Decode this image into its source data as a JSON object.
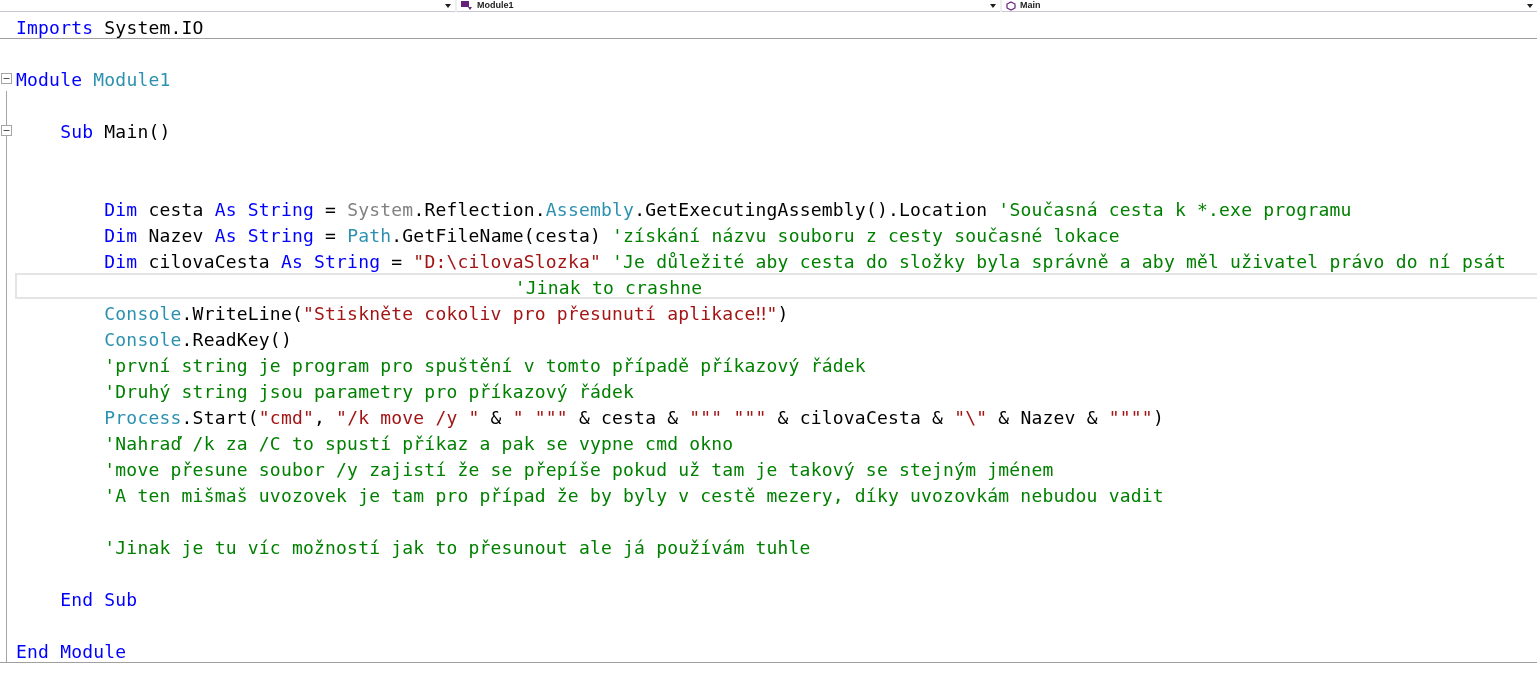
{
  "navigation_bar": {
    "dropdowns": [
      {
        "kind": "project"
      },
      {
        "kind": "type",
        "label": "Module1"
      },
      {
        "kind": "member",
        "label": "Main"
      }
    ]
  },
  "lines": [
    {
      "current": false,
      "separator_below": true,
      "tokens": [
        {
          "kind": "keyword",
          "text": "Imports"
        },
        {
          "kind": "plain",
          "text": " System.IO"
        }
      ]
    },
    {
      "current": false,
      "separator_below": false
    },
    {
      "current": false,
      "separator_below": false,
      "expanded": true,
      "tokens": [
        {
          "kind": "keyword",
          "text": "Module"
        },
        {
          "kind": "type",
          "text": " Module1"
        }
      ]
    },
    {
      "current": false,
      "separator_below": false
    },
    {
      "current": false,
      "separator_below": false,
      "expanded": true,
      "tokens": [
        {
          "kind": "keyword",
          "text": "    Sub"
        },
        {
          "kind": "plain",
          "text": " Main()"
        }
      ]
    },
    {
      "current": false,
      "separator_below": false
    },
    {
      "current": false,
      "separator_below": false
    },
    {
      "current": false,
      "separator_below": false,
      "tokens": [
        {
          "kind": "keyword",
          "text": "        Dim"
        },
        {
          "kind": "plain",
          "text": " cesta "
        },
        {
          "kind": "keyword",
          "text": "As String"
        },
        {
          "kind": "plain",
          "text": " = "
        },
        {
          "kind": "grey",
          "text": "System"
        },
        {
          "kind": "plain",
          "text": ".Reflection."
        },
        {
          "kind": "type",
          "text": "Assembly"
        },
        {
          "kind": "plain",
          "text": ".GetExecutingAssembly().Location "
        },
        {
          "kind": "comment",
          "text": "'Současná cesta k *.exe programu"
        }
      ]
    },
    {
      "current": false,
      "separator_below": false,
      "tokens": [
        {
          "kind": "keyword",
          "text": "        Dim"
        },
        {
          "kind": "plain",
          "text": " Nazev "
        },
        {
          "kind": "keyword",
          "text": "As String"
        },
        {
          "kind": "plain",
          "text": " = "
        },
        {
          "kind": "type",
          "text": "Path"
        },
        {
          "kind": "plain",
          "text": ".GetFileName(cesta) "
        },
        {
          "kind": "comment",
          "text": "'získání názvu souboru z cesty současné lokace"
        }
      ]
    },
    {
      "current": false,
      "separator_below": false,
      "tokens": [
        {
          "kind": "keyword",
          "text": "        Dim"
        },
        {
          "kind": "plain",
          "text": " cilovaCesta "
        },
        {
          "kind": "keyword",
          "text": "As String"
        },
        {
          "kind": "plain",
          "text": " = "
        },
        {
          "kind": "string",
          "text": "\"D:\\cilovaSlozka\""
        },
        {
          "kind": "comment",
          "text": " 'Je důležité aby cesta do složky byla správně a aby měl uživatel právo do ní psát"
        }
      ]
    },
    {
      "current": true,
      "separator_below": false,
      "tokens": [
        {
          "kind": "comment",
          "text": "                                             'Jinak to crashne"
        }
      ]
    },
    {
      "current": false,
      "separator_below": false,
      "tokens": [
        {
          "kind": "type",
          "text": "        Console"
        },
        {
          "kind": "plain",
          "text": ".WriteLine("
        },
        {
          "kind": "string",
          "text": "\"Stiskněte cokoliv pro přesunutí aplikace‼\""
        },
        {
          "kind": "plain",
          "text": ")"
        }
      ]
    },
    {
      "current": false,
      "separator_below": false,
      "tokens": [
        {
          "kind": "type",
          "text": "        Console"
        },
        {
          "kind": "plain",
          "text": ".ReadKey()"
        }
      ]
    },
    {
      "current": false,
      "separator_below": false,
      "tokens": [
        {
          "kind": "comment",
          "text": "        'první string je program pro spuštění v tomto případě příkazový řádek"
        }
      ]
    },
    {
      "current": false,
      "separator_below": false,
      "tokens": [
        {
          "kind": "comment",
          "text": "        'Druhý string jsou parametry pro příkazový řádek"
        }
      ]
    },
    {
      "current": false,
      "separator_below": false,
      "tokens": [
        {
          "kind": "type",
          "text": "        Process"
        },
        {
          "kind": "plain",
          "text": ".Start("
        },
        {
          "kind": "string",
          "text": "\"cmd\""
        },
        {
          "kind": "plain",
          "text": ", "
        },
        {
          "kind": "string",
          "text": "\"/k move /y \""
        },
        {
          "kind": "plain",
          "text": " & "
        },
        {
          "kind": "string",
          "text": "\" \"\"\""
        },
        {
          "kind": "plain",
          "text": " & cesta & "
        },
        {
          "kind": "string",
          "text": "\"\"\" \"\"\""
        },
        {
          "kind": "plain",
          "text": " & cilovaCesta & "
        },
        {
          "kind": "string",
          "text": "\"\\\""
        },
        {
          "kind": "plain",
          "text": " & Nazev & "
        },
        {
          "kind": "string",
          "text": "\"\"\"\""
        },
        {
          "kind": "plain",
          "text": ")"
        }
      ]
    },
    {
      "current": false,
      "separator_below": false,
      "tokens": [
        {
          "kind": "comment",
          "text": "        'Nahraď /k za /C to spustí příkaz a pak se vypne cmd okno"
        }
      ]
    },
    {
      "current": false,
      "separator_below": false,
      "tokens": [
        {
          "kind": "comment",
          "text": "        'move přesune soubor /y zajistí že se přepíše pokud už tam je takový se stejným jménem"
        }
      ]
    },
    {
      "current": false,
      "separator_below": false,
      "tokens": [
        {
          "kind": "comment",
          "text": "        'A ten mišmaš uvozovek je tam pro případ že by byly v cestě mezery, díky uvozovkám nebudou vadit"
        }
      ]
    },
    {
      "current": false,
      "separator_below": false
    },
    {
      "current": false,
      "separator_below": false,
      "tokens": [
        {
          "kind": "comment",
          "text": "        'Jinak je tu víc možností jak to přesunout ale já používám tuhle"
        }
      ]
    },
    {
      "current": false,
      "separator_below": false
    },
    {
      "current": false,
      "separator_below": false,
      "tokens": [
        {
          "kind": "keyword",
          "text": "    End Sub"
        }
      ]
    },
    {
      "current": false,
      "separator_below": false
    },
    {
      "current": false,
      "separator_below": true,
      "tokens": [
        {
          "kind": "keyword",
          "text": "End Module"
        }
      ]
    }
  ]
}
